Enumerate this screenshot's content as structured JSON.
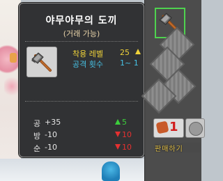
{
  "item": {
    "name": "야무야무의 도끼",
    "subtitle": "(거래 가능)",
    "icon": "axe-icon"
  },
  "requirements": [
    {
      "label": "착용 레벨",
      "value": "25",
      "color": "#f0d23a",
      "indicator": "up-arrow"
    },
    {
      "label": "공격 횟수",
      "value": "1~ 1",
      "color": "#47c3e6"
    }
  ],
  "stats": [
    {
      "name": "공",
      "value": "+35",
      "compare": "5",
      "direction": "up"
    },
    {
      "name": "방",
      "value": "-10",
      "compare": "10",
      "direction": "down"
    },
    {
      "name": "순",
      "value": "-10",
      "compare": "10",
      "direction": "down"
    }
  ],
  "inventory": {
    "selected_item": "axe-icon",
    "quantity": "1",
    "sell_label": "판매하기"
  },
  "colors": {
    "tooltip_bg": "#28282a",
    "up": "#3ccf3c",
    "down": "#e53030",
    "selected_border": "#4fd24f"
  }
}
